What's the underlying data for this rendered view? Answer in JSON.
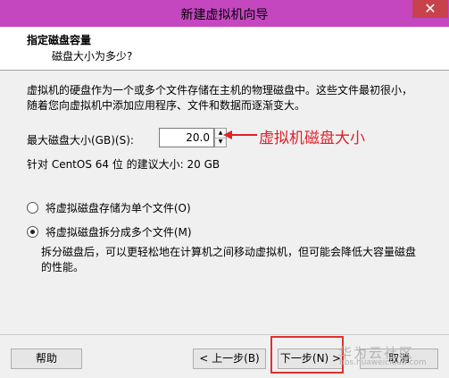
{
  "window": {
    "title": "新建虚拟机向导",
    "close_glyph": "✕"
  },
  "header": {
    "title": "指定磁盘容量",
    "subtitle": "磁盘大小为多少?"
  },
  "content": {
    "description": "虚拟机的硬盘作为一个或多个文件存储在主机的物理磁盘中。这些文件最初很小，随着您向虚拟机中添加应用程序、文件和数据而逐渐变大。",
    "max_size_label": "最大磁盘大小(GB)(S):",
    "max_size_value": "20.0",
    "annotation": "虚拟机磁盘大小",
    "recommended": "针对 CentOS 64 位 的建议大小: 20 GB",
    "radio_single": "将虚拟磁盘存储为单个文件(O)",
    "radio_multi": "将虚拟磁盘拆分成多个文件(M)",
    "split_note": "拆分磁盘后，可以更轻松地在计算机之间移动虚拟机，但可能会降低大容量磁盘的性能。"
  },
  "footer": {
    "help": "帮助",
    "back": "< 上一步(B)",
    "next": "下一步(N) >",
    "cancel": "取消"
  },
  "watermark": {
    "text": "华为云社区",
    "url": "bbs.huaweicloud.com"
  },
  "colors": {
    "titlebar": "#c447c0",
    "close": "#c7424b",
    "annotation": "#e0202a"
  }
}
